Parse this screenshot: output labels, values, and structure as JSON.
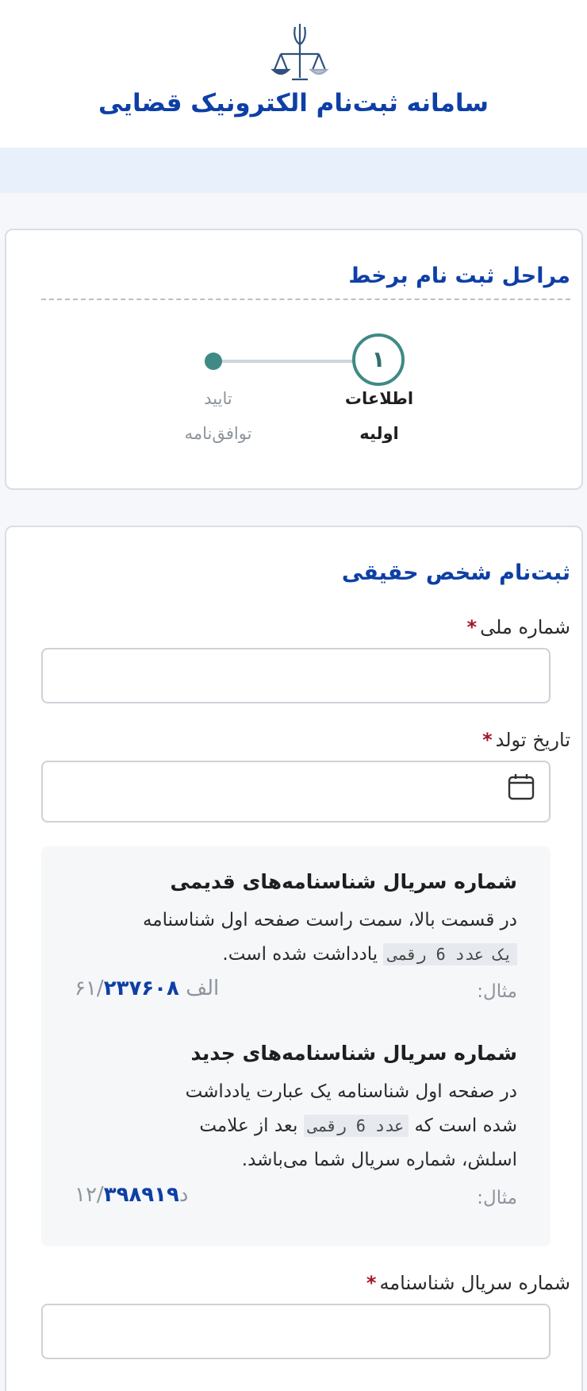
{
  "header": {
    "title": "سامانه ثبت‌نام الکترونیک قضایی",
    "emblem_icon": "judiciary-emblem-icon"
  },
  "steps": {
    "title": "مراحل ثبت نام برخط",
    "step1_number": "۱",
    "step1_label_line1": "اطلاعات",
    "step1_label_line2": "اولیه",
    "step2_label_line1": "تایید",
    "step2_label_line2": "توافق‌نامه",
    "active_color": "#3f8a85"
  },
  "form": {
    "title": "ثبت‌نام شخص حقیقی",
    "national_id_label": "شماره ملی",
    "required_mark": "*",
    "national_id_value": "",
    "birth_date_label": "تاریخ تولد",
    "birth_date_value": "",
    "calendar_icon": "calendar-icon",
    "serial_label": "شماره سریال شناسنامه",
    "serial_value": ""
  },
  "info": {
    "old_title": "شماره سریال شناسنامه‌های قدیمی",
    "old_text_1": "در قسمت بالا، سمت راست صفحه اول شناسنامه",
    "old_code": "یک عدد 6 رقمی",
    "old_text_2": "یادداشت شده است.",
    "example_label": "مثال:",
    "old_example_strong": "۲۳۷۶۰۸",
    "old_example_muted": "۶۱/الف",
    "new_title": "شماره سریال شناسنامه‌های جدید",
    "new_text_1": "در صفحه اول شناسنامه یک عبارت یادداشت",
    "new_text_2a": "شده است که",
    "new_code": "عدد 6 رقمی",
    "new_text_2b": "بعد از علامت",
    "new_text_3": "اسلش، شماره سریال شما می‌باشد.",
    "new_example_muted": "۱۲/د",
    "new_example_strong": "۳۹۸۹۱۹"
  }
}
